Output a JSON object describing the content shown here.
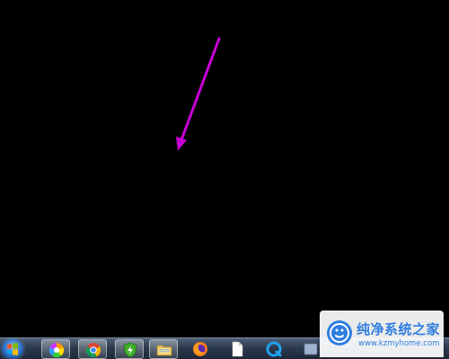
{
  "taskbar": {
    "items": [
      {
        "name": "start-button",
        "icon": "windows-logo-icon"
      },
      {
        "name": "photo-app",
        "icon": "color-wheel-icon"
      },
      {
        "name": "chrome",
        "icon": "chrome-icon"
      },
      {
        "name": "security-app",
        "icon": "green-shield-icon"
      },
      {
        "name": "file-explorer",
        "icon": "folder-icon"
      },
      {
        "name": "firefox",
        "icon": "firefox-icon"
      },
      {
        "name": "blank-document",
        "icon": "document-icon"
      },
      {
        "name": "browser-app",
        "icon": "blue-circle-icon"
      }
    ]
  },
  "annotation": {
    "color": "#c800d6"
  },
  "watermark": {
    "name": "纯净系统之家",
    "url": "www.kzmyhome.com"
  }
}
